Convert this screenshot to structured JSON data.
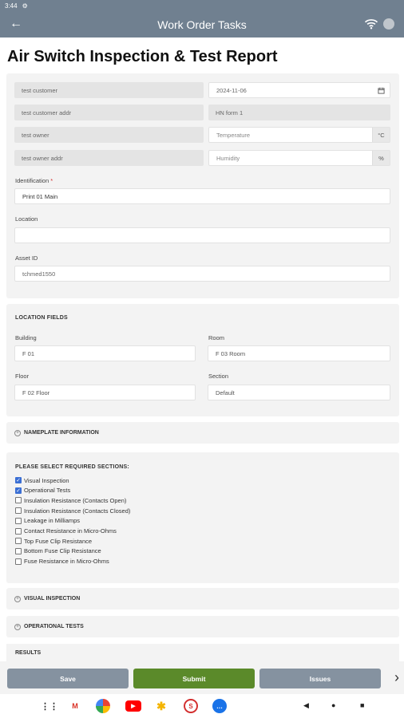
{
  "status": {
    "time": "3:44"
  },
  "appbar": {
    "title": "Work Order Tasks"
  },
  "page": {
    "title": "Air Switch Inspection & Test Report"
  },
  "info": {
    "customer": "test customer",
    "date": "2024-11-06",
    "customer_addr": "test customer addr",
    "form": "HN form 1",
    "owner": "test owner",
    "temperature_placeholder": "Temperature",
    "temperature_unit": "°C",
    "owner_addr": "test owner addr",
    "humidity_placeholder": "Humidity",
    "humidity_unit": "%"
  },
  "identification": {
    "label": "Identification",
    "required_mark": "*",
    "value": "Print 01 Main"
  },
  "location": {
    "label": "Location",
    "value": ""
  },
  "asset": {
    "label": "Asset ID",
    "value": "tchmed1550"
  },
  "location_fields": {
    "heading": "LOCATION FIELDS",
    "building_label": "Building",
    "building_value": "F 01",
    "room_label": "Room",
    "room_value": "F 03 Room",
    "floor_label": "Floor",
    "floor_value": "F 02 Floor",
    "section_label": "Section",
    "section_value": "Default"
  },
  "nameplate": {
    "label": "NAMEPLATE INFORMATION"
  },
  "required_sections": {
    "heading": "PLEASE SELECT REQUIRED SECTIONS:",
    "items": [
      {
        "label": "Visual Inspection",
        "checked": true
      },
      {
        "label": "Operational Tests",
        "checked": true
      },
      {
        "label": "Insulation Resistance (Contacts Open)",
        "checked": false
      },
      {
        "label": "Insulation Resistance (Contacts Closed)",
        "checked": false
      },
      {
        "label": "Leakage in Milliamps",
        "checked": false
      },
      {
        "label": "Contact Resistance in Micro-Ohms",
        "checked": false
      },
      {
        "label": "Top Fuse Clip Resistance",
        "checked": false
      },
      {
        "label": "Bottom Fuse Clip Resistance",
        "checked": false
      },
      {
        "label": "Fuse Resistance in Micro-Ohms",
        "checked": false
      }
    ]
  },
  "visual_inspection": {
    "label": "VISUAL INSPECTION"
  },
  "operational_tests": {
    "label": "OPERATIONAL TESTS"
  },
  "results": {
    "label": "RESULTS"
  },
  "actions": {
    "save": "Save",
    "submit": "Submit",
    "issues": "Issues"
  },
  "colors": {
    "appbar": "#708090",
    "submit": "#5b8a2a",
    "action_grey": "#8592a0",
    "checkbox": "#3b6fd4"
  }
}
